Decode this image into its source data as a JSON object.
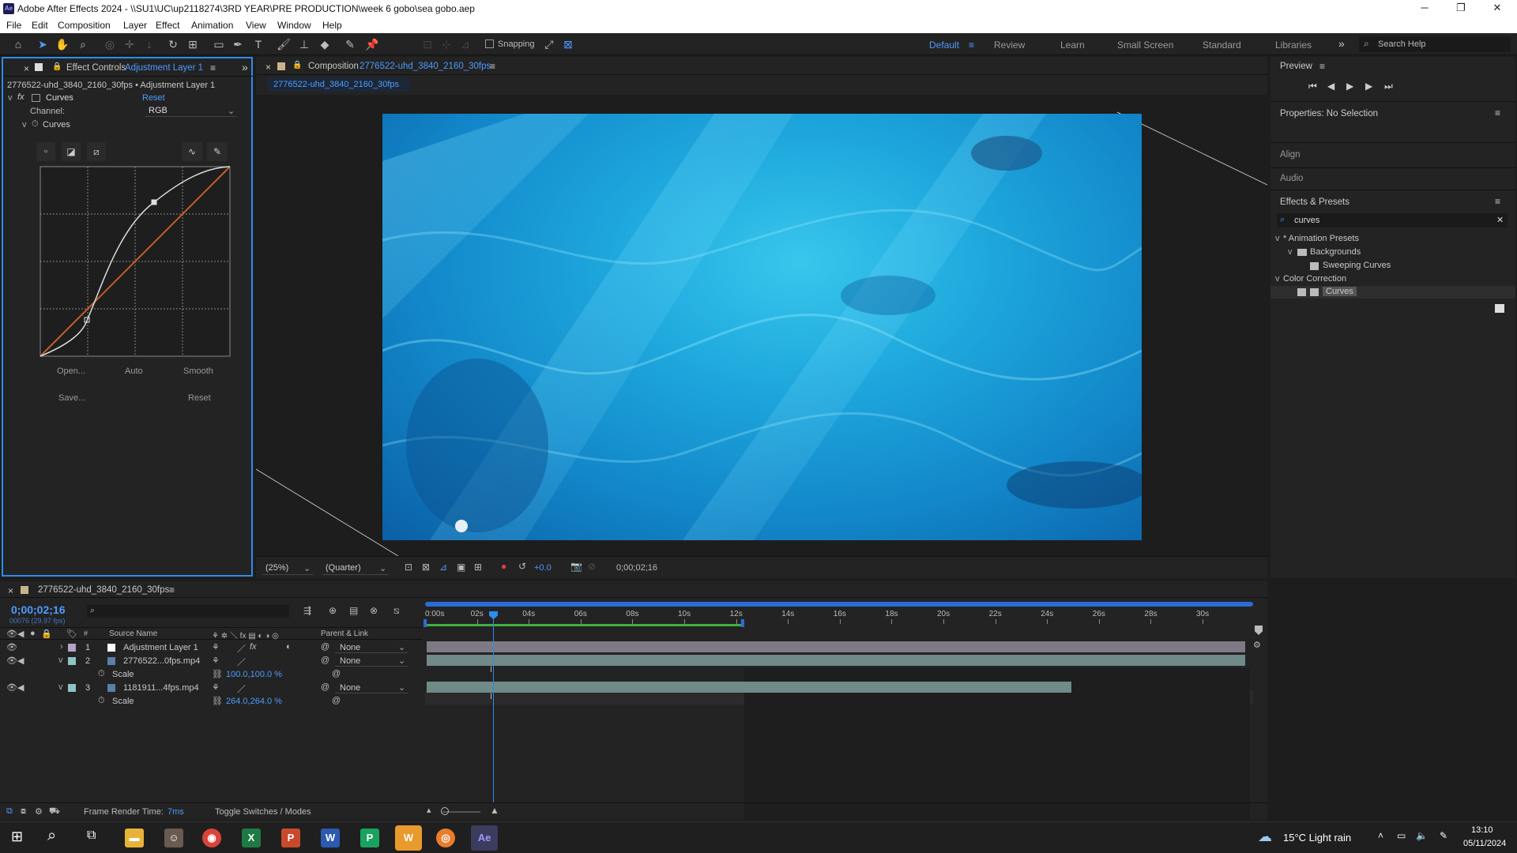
{
  "window": {
    "title": "Adobe After Effects 2024 - \\\\SU1\\UC\\up2118274\\3RD YEAR\\PRE PRODUCTION\\week 6 gobo\\sea gobo.aep",
    "min": "─",
    "max": "❐",
    "close": "✕",
    "app_badge": "Ae"
  },
  "menu": [
    "File",
    "Edit",
    "Composition",
    "Layer",
    "Effect",
    "Animation",
    "View",
    "Window",
    "Help"
  ],
  "toolbar": {
    "snapping": "Snapping",
    "workspaces": [
      "Default",
      "Review",
      "Learn",
      "Small Screen",
      "Standard",
      "Libraries"
    ],
    "search_help": "Search Help",
    "more": "»"
  },
  "effect_controls": {
    "tab_label": "Effect Controls",
    "tab_layer": "Adjustment Layer 1",
    "breadcrumb": "2776522-uhd_3840_2160_30fps • Adjustment Layer 1",
    "effect_name": "Curves",
    "reset": "Reset",
    "channel_label": "Channel:",
    "channel_value": "RGB",
    "curves_label": "Curves",
    "buttons": [
      "Open...",
      "Auto",
      "Smooth",
      "Save...",
      "Reset"
    ]
  },
  "composition": {
    "tab_label": "Composition",
    "tab_name": "2776522-uhd_3840_2160_30fps",
    "subtab": "2776522-uhd_3840_2160_30fps",
    "zoom": "(25%)",
    "resolution": "(Quarter)",
    "exposure": "+0.0",
    "timecode": "0;00;02;16"
  },
  "preview": {
    "title": "Preview"
  },
  "properties": {
    "title": "Properties: No Selection"
  },
  "align": {
    "title": "Align"
  },
  "audio": {
    "title": "Audio"
  },
  "effects_presets": {
    "title": "Effects & Presets",
    "search": "curves",
    "tree": [
      {
        "label": "* Animation Presets",
        "indent": 0
      },
      {
        "label": "Backgrounds",
        "indent": 1
      },
      {
        "label": "Sweeping Curves",
        "indent": 2
      },
      {
        "label": "Color Correction",
        "indent": 0
      },
      {
        "label": "Curves",
        "indent": 2
      }
    ]
  },
  "timeline": {
    "tab_name": "2776522-uhd_3840_2160_30fps",
    "timecode": "0;00;02;16",
    "frame_info": "00076 (29.97 fps)",
    "col_source": "Source Name",
    "col_parent": "Parent & Link",
    "ruler": [
      "0:00s",
      "02s",
      "04s",
      "06s",
      "08s",
      "10s",
      "12s",
      "14s",
      "16s",
      "18s",
      "20s",
      "22s",
      "24s",
      "26s",
      "28s",
      "30s"
    ],
    "layers": [
      {
        "num": "1",
        "name": "Adjustment Layer 1",
        "parent": "None"
      },
      {
        "num": "2",
        "name": "2776522...0fps.mp4",
        "parent": "None",
        "prop": "Scale",
        "prop_value": "100.0,100.0 %"
      },
      {
        "num": "3",
        "name": "1181911...4fps.mp4",
        "parent": "None",
        "prop": "Scale",
        "prop_value": "264.0,264.0 %"
      }
    ],
    "render_time_label": "Frame Render Time:",
    "render_time": "7ms",
    "toggle": "Toggle Switches / Modes"
  },
  "taskbar": {
    "weather": "15°C  Light rain",
    "time": "13:10",
    "date": "05/11/2024"
  }
}
